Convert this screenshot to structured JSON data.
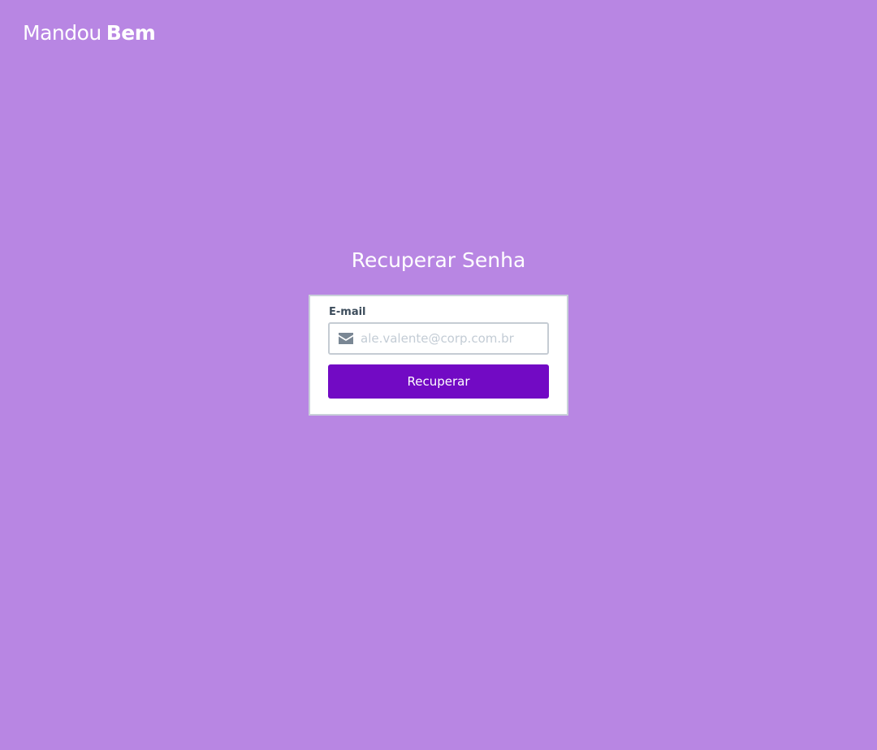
{
  "brand": {
    "name_light": "Mandou",
    "name_bold": "Bem"
  },
  "page": {
    "title": "Recuperar Senha"
  },
  "form": {
    "email_label": "E-mail",
    "email_placeholder": "ale.valente@corp.com.br",
    "email_value": "",
    "email_icon": "envelope-icon",
    "submit_label": "Recuperar"
  },
  "colors": {
    "background": "#b886e3",
    "primary_button": "#720ac4",
    "card": "#ffffff",
    "label_text": "#3d4d5c"
  }
}
